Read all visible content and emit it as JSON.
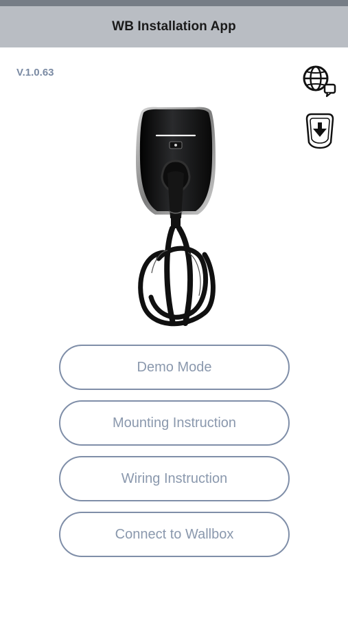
{
  "header": {
    "title": "WB Installation App"
  },
  "app": {
    "version": "V.1.0.63"
  },
  "icons": {
    "language": "globe-chat-icon",
    "download": "download-arrow-icon",
    "charger_image": "wallbox-charger-image"
  },
  "colors": {
    "header_background": "#b9bdc3",
    "status_strip": "#767d86",
    "button_border": "#7f8ea8",
    "button_text": "#8a98ad",
    "version_text": "#7a8aa3"
  },
  "actions": [
    {
      "label": "Demo Mode"
    },
    {
      "label": "Mounting Instruction"
    },
    {
      "label": "Wiring Instruction"
    },
    {
      "label": "Connect to Wallbox"
    }
  ]
}
